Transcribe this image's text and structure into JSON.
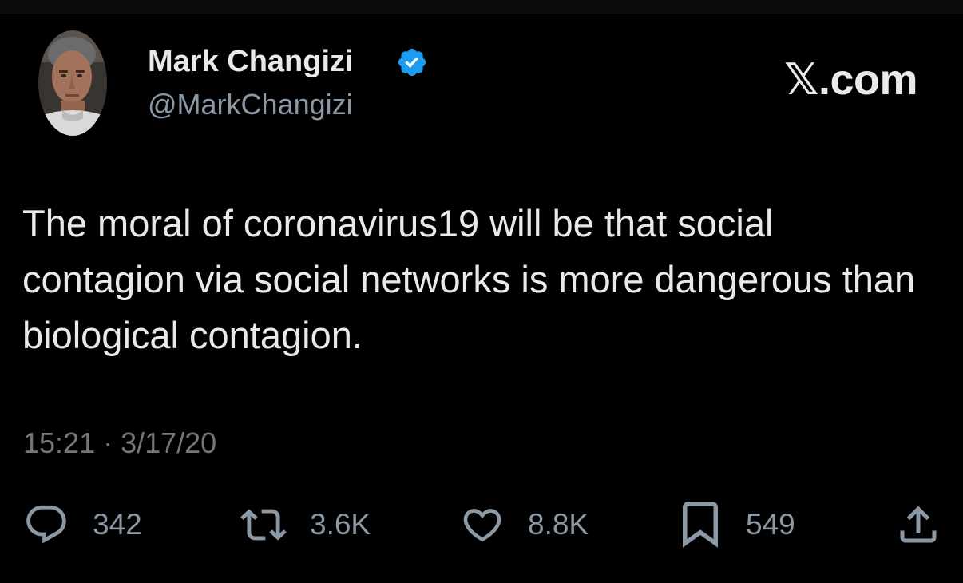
{
  "author": {
    "name": "Mark Changizi",
    "handle": "@MarkChangizi",
    "verified": true,
    "avatar_icon": "profile-photo"
  },
  "brand": "𝕏.com",
  "tweet": {
    "text": "The moral of coronavirus19 will be that social contagion via social networks is more dangerous than biological contagion.",
    "timestamp": "15:21 · 3/17/20"
  },
  "actions": {
    "reply": {
      "icon": "reply-icon",
      "count": "342"
    },
    "repost": {
      "icon": "repost-icon",
      "count": "3.6K"
    },
    "like": {
      "icon": "heart-icon",
      "count": "8.8K"
    },
    "bookmark": {
      "icon": "bookmark-icon",
      "count": "549"
    },
    "share": {
      "icon": "share-icon"
    }
  },
  "colors": {
    "background": "#000000",
    "primary_text": "#e7e9ea",
    "secondary_text": "#8b98a5",
    "timestamp_text": "#71767b",
    "verified_badge": "#1d9bf0"
  }
}
